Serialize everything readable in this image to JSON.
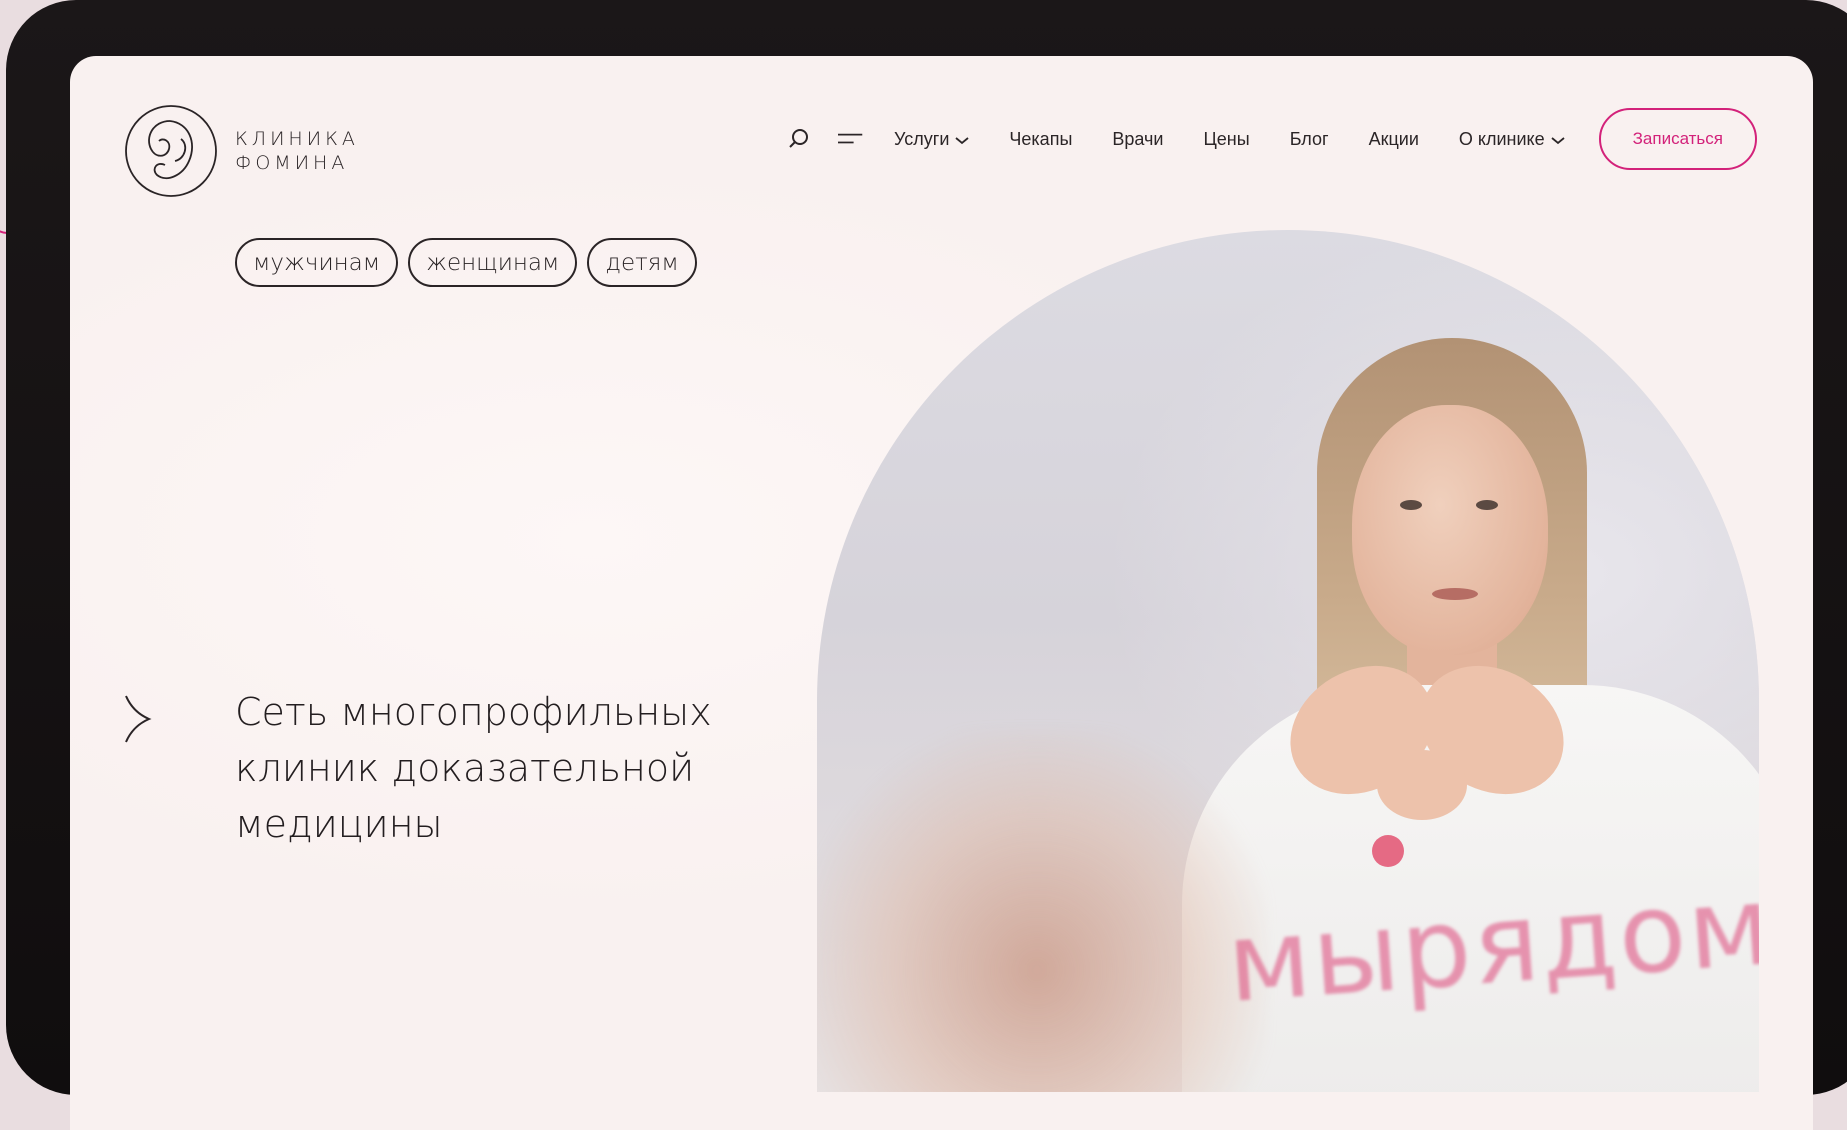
{
  "logo": {
    "line1": "КЛИНИКА",
    "line2": "ФОМИНА",
    "icon": "embryo-logo-icon"
  },
  "nav": {
    "search_icon": "search-icon",
    "menu_icon": "menu-icon",
    "items": [
      {
        "label": "Услуги",
        "dropdown": true
      },
      {
        "label": "Чекапы",
        "dropdown": false
      },
      {
        "label": "Врачи",
        "dropdown": false
      },
      {
        "label": "Цены",
        "dropdown": false
      },
      {
        "label": "Блог",
        "dropdown": false
      },
      {
        "label": "Акции",
        "dropdown": false
      },
      {
        "label": "О клинике",
        "dropdown": true
      }
    ],
    "cta_label": "Записаться"
  },
  "audience": {
    "pills": [
      "мужчинам",
      "женщинам",
      "детям"
    ]
  },
  "hero": {
    "arrow_icon": "chevron-right-icon",
    "title_lines": [
      "Сеть многопрофильных",
      "клиник доказательной",
      "медицины"
    ],
    "photo_overlay_text": "мырядом"
  },
  "colors": {
    "accent": "#d3227a",
    "background": "#f9f1f0",
    "text": "#231e20",
    "device_frame": "#141112"
  }
}
